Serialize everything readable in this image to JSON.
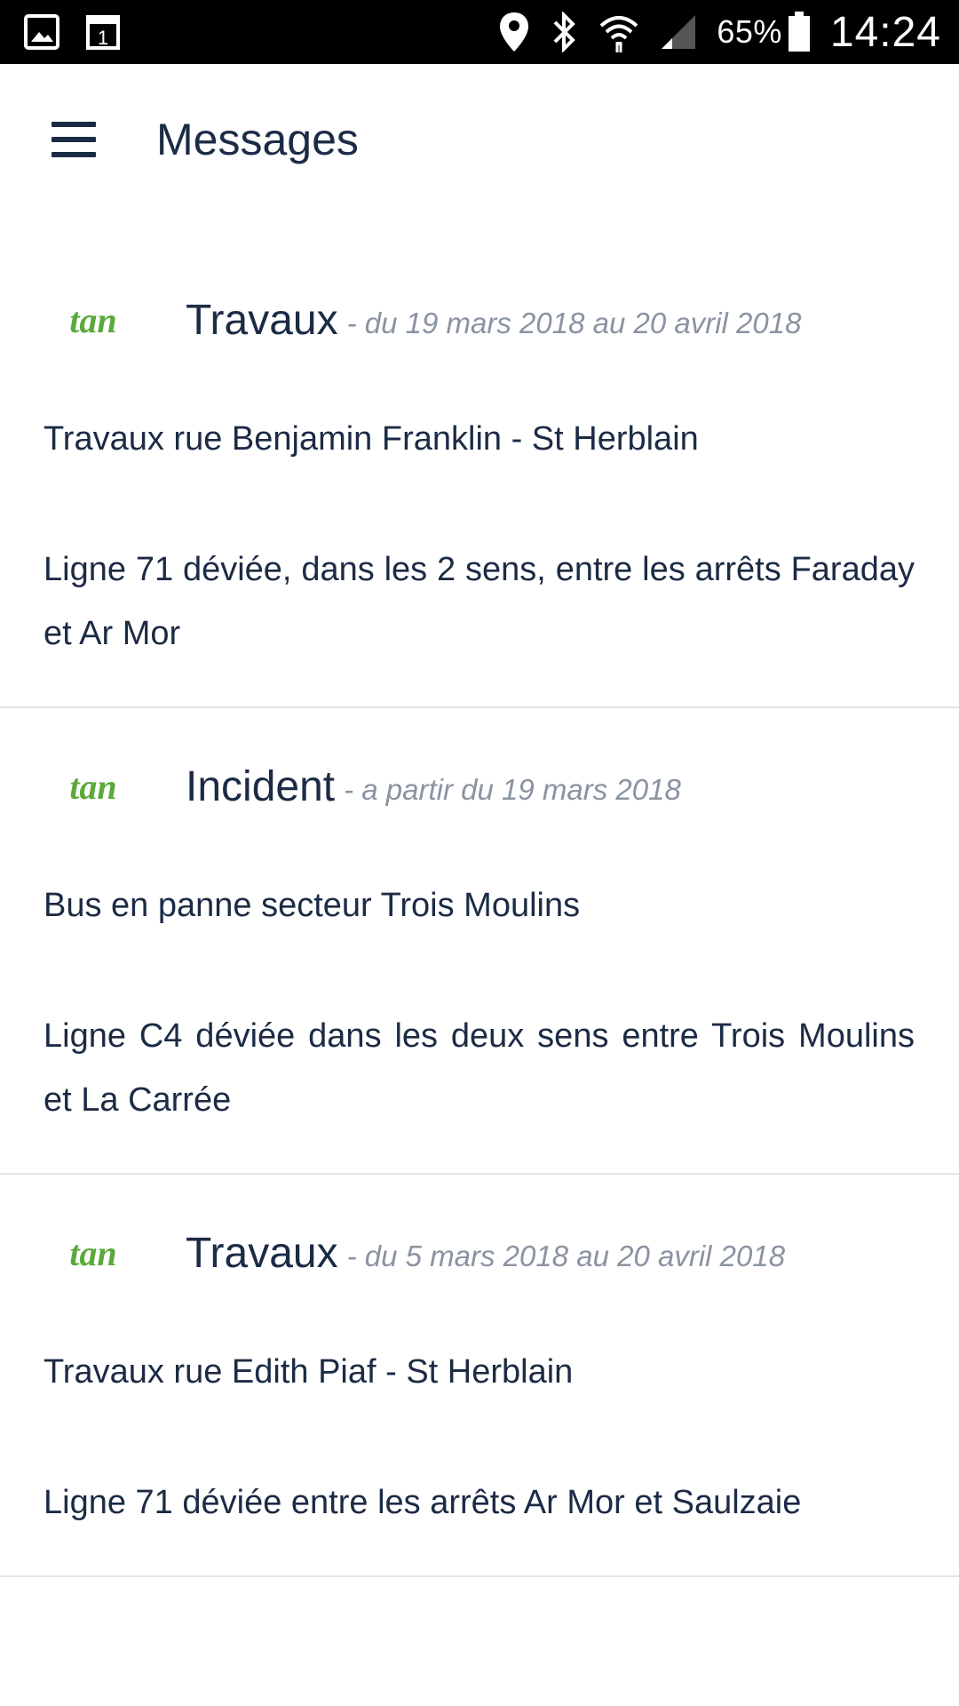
{
  "status_bar": {
    "left_icons": [
      "gallery-icon",
      "calendar-icon"
    ],
    "right_icons": [
      "location-icon",
      "bluetooth-icon",
      "wifi-icon",
      "signal-icon"
    ],
    "battery_percent": "65%",
    "time": "14:24"
  },
  "header": {
    "menu_icon": "hamburger-menu-icon",
    "title": "Messages"
  },
  "colors": {
    "text": "#1c2b45",
    "date_text": "#8a93a2",
    "logo_green": "#5aa93a",
    "divider": "#e4e4e4"
  },
  "messages": [
    {
      "logo": "tan",
      "type": "Travaux",
      "date": "- du 19 mars 2018 au 20 avril 2018",
      "subject": "Travaux rue Benjamin Franklin - St Herblain",
      "body": "Ligne 71 déviée, dans les 2 sens, entre les arrêts Faraday et Ar Mor"
    },
    {
      "logo": "tan",
      "type": "Incident",
      "date": "- a partir du 19 mars 2018",
      "subject": "Bus en panne secteur Trois Moulins",
      "body": "Ligne C4 déviée dans les deux sens entre Trois Moulins et La Carrée"
    },
    {
      "logo": "tan",
      "type": "Travaux",
      "date": "- du 5 mars 2018 au 20 avril 2018",
      "subject": "Travaux rue Edith Piaf - St Herblain",
      "body": "Ligne 71 déviée entre les arrêts Ar Mor et Saulzaie"
    }
  ]
}
